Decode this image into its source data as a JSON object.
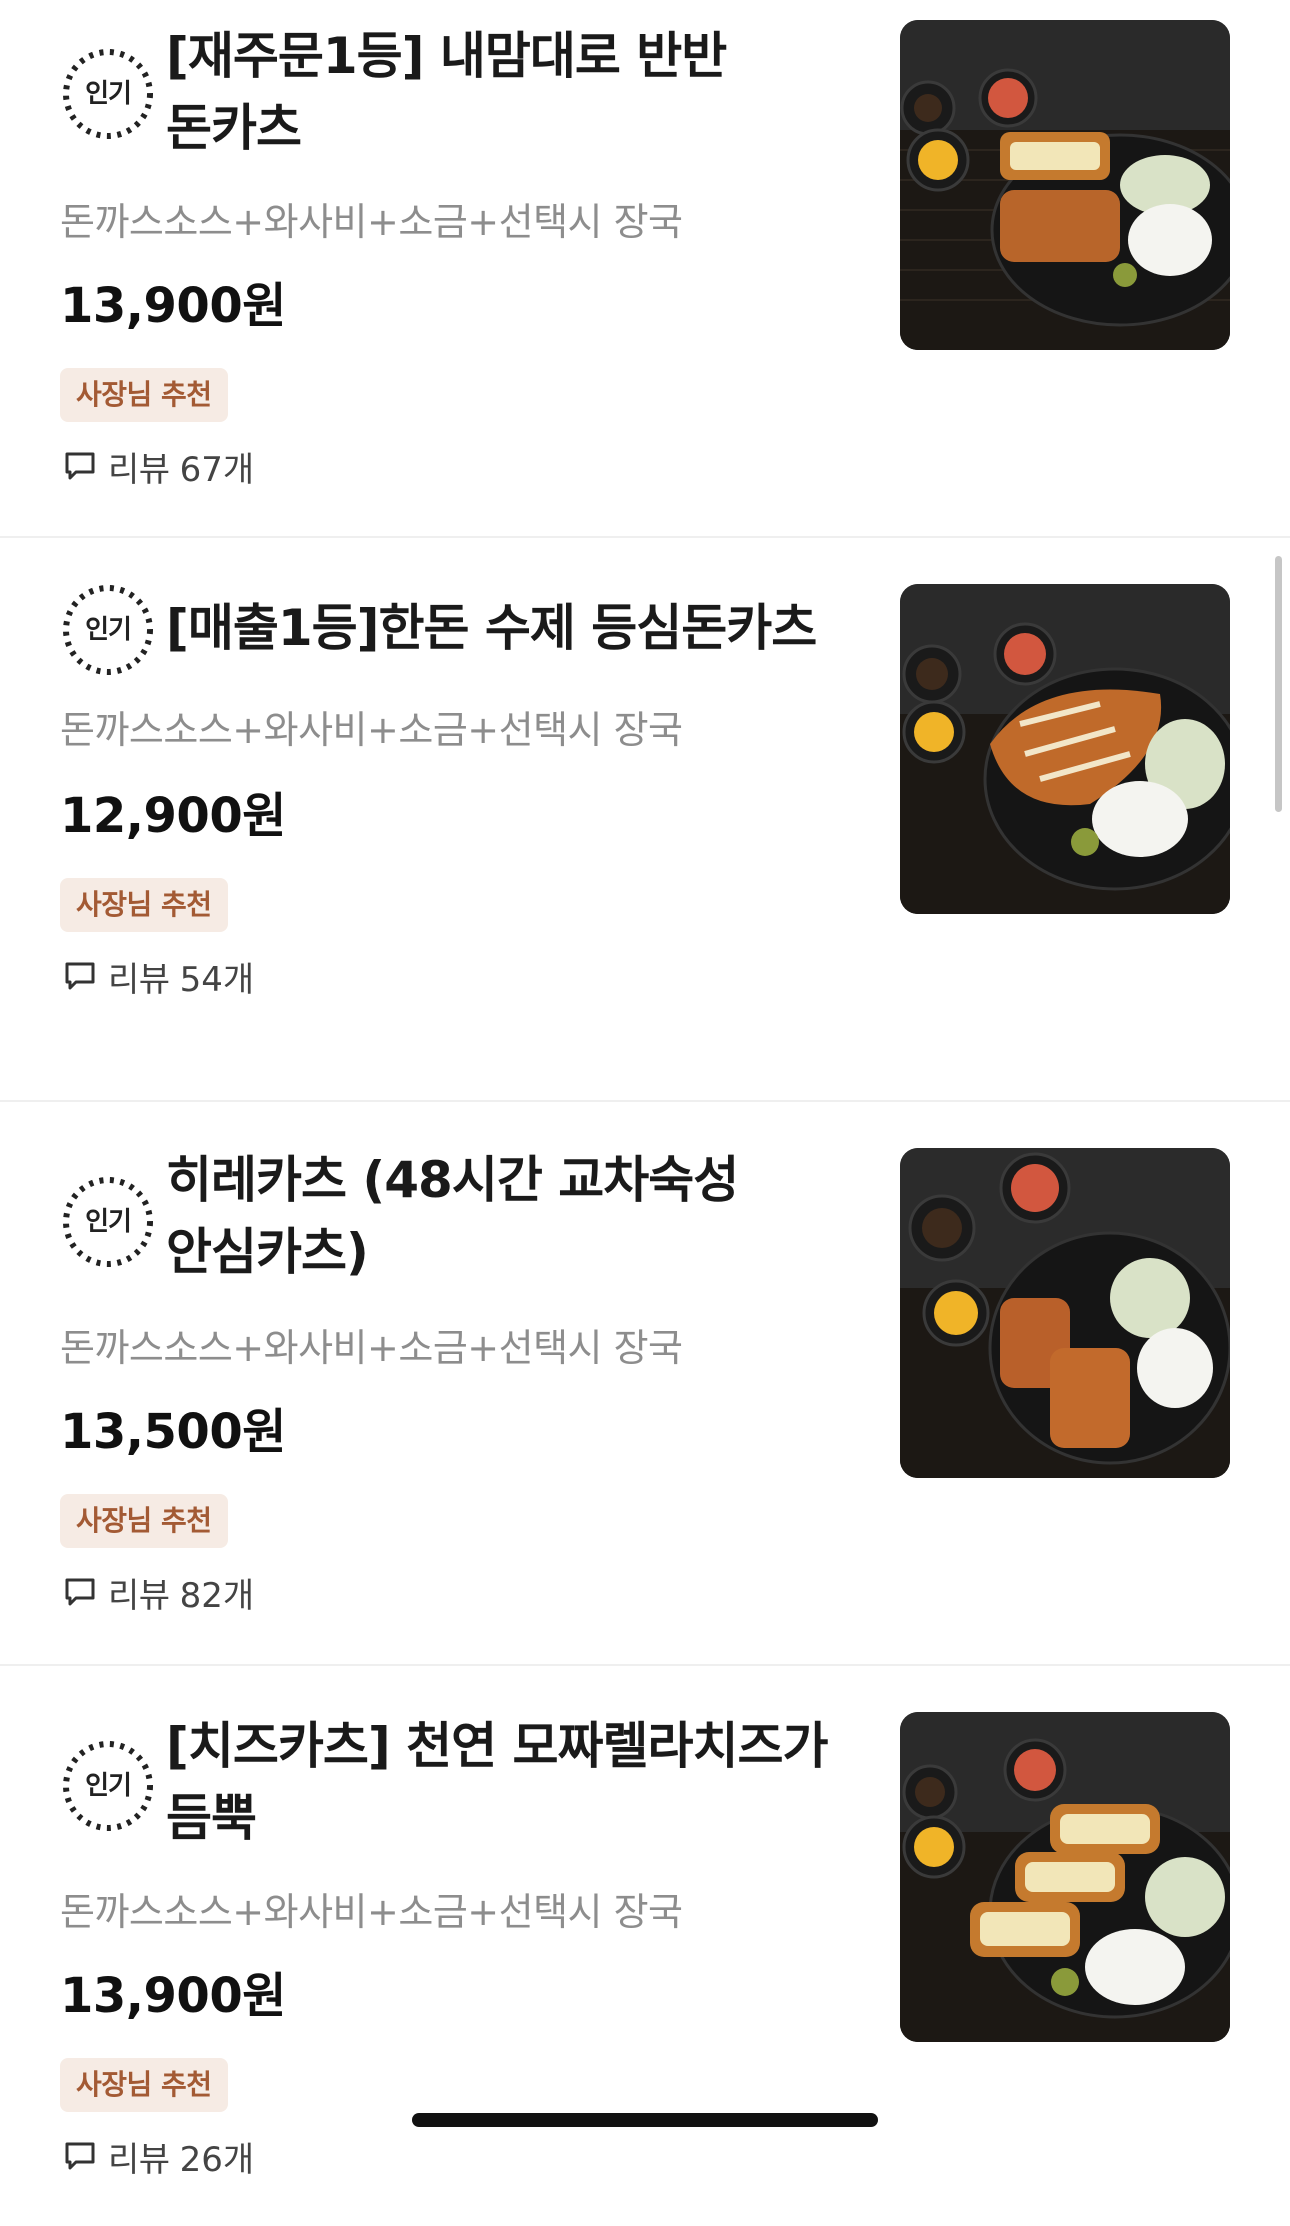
{
  "menu": {
    "items": [
      {
        "badge": "인기",
        "title": "[재주문1등] 내맘대로 반반 돈카츠",
        "description": "돈까스소스+와사비+소금+선택시 장국",
        "price": "13,900원",
        "tag": "사장님 추천",
        "review_label": "리뷰",
        "review_count": "67개",
        "image_icon": "food-photo-half-half-tonkatsu"
      },
      {
        "badge": "인기",
        "title": "[매출1등]한돈 수제 등심돈카츠",
        "description": "돈까스소스+와사비+소금+선택시 장국",
        "price": "12,900원",
        "tag": "사장님 추천",
        "review_label": "리뷰",
        "review_count": "54개",
        "image_icon": "food-photo-loin-tonkatsu"
      },
      {
        "badge": "인기",
        "title": "히레카츠 (48시간 교차숙성 안심카츠)",
        "description": "돈까스소스+와사비+소금+선택시 장국",
        "price": "13,500원",
        "tag": "사장님 추천",
        "review_label": "리뷰",
        "review_count": "82개",
        "image_icon": "food-photo-hirekatsu"
      },
      {
        "badge": "인기",
        "title": "[치즈카츠] 천연 모짜렐라치즈가 듬뿍",
        "description": "돈까스소스+와사비+소금+선택시 장국",
        "price": "13,900원",
        "tag": "사장님 추천",
        "review_label": "리뷰",
        "review_count": "26개",
        "image_icon": "food-photo-cheese-katsu"
      }
    ]
  },
  "colors": {
    "tag_background": "#f6ebe4",
    "tag_text": "#a35a34",
    "description_text": "#8d8d8d",
    "divider": "#efefef"
  }
}
